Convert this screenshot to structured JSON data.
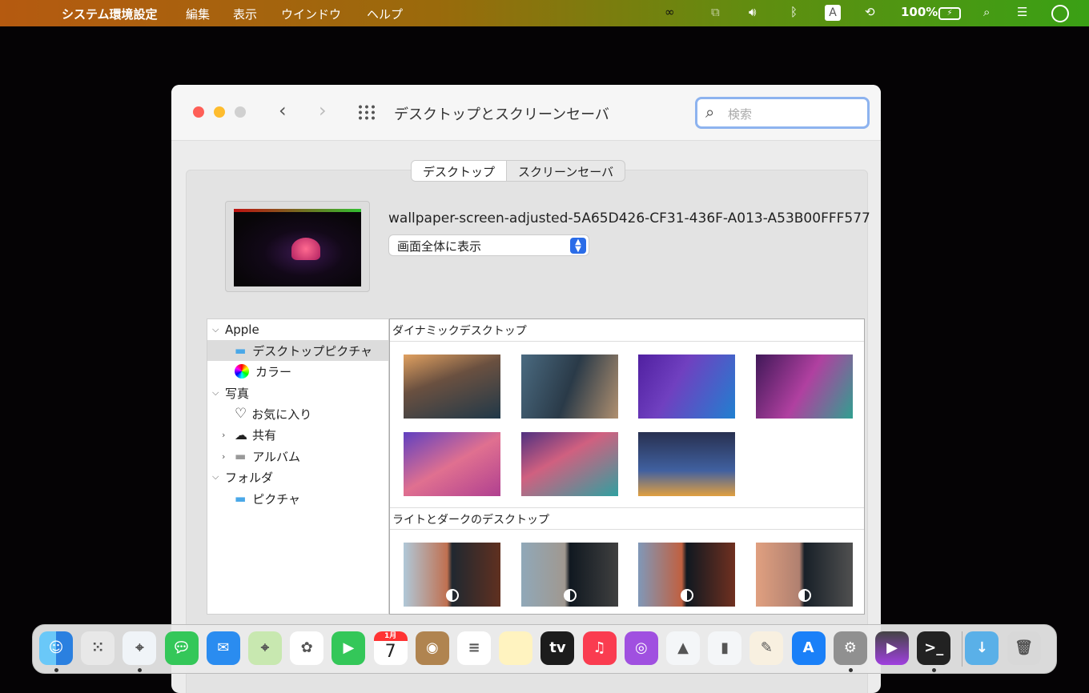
{
  "menubar": {
    "apple": "",
    "app": "システム環境設定",
    "items": [
      "編集",
      "表示",
      "ウインドウ",
      "ヘルプ"
    ],
    "status": {
      "battery": "100%",
      "input": "A"
    }
  },
  "window": {
    "title": "デスクトップとスクリーンセーバ",
    "search_placeholder": "検索",
    "tabs": [
      "デスクトップ",
      "スクリーンセーバ"
    ],
    "selected_tab": 0,
    "wallpaper_name": "wallpaper-screen-adjusted-5A65D426-CF31-436F-A013-A53B00FFF577",
    "fit_mode": "画面全体に表示",
    "sidebar": [
      {
        "label": "Apple",
        "type": "group"
      },
      {
        "label": "デスクトップピクチャ",
        "icon": "folder-icon",
        "selected": true
      },
      {
        "label": "カラー",
        "icon": "color-wheel-icon"
      },
      {
        "label": "写真",
        "type": "group"
      },
      {
        "label": "お気に入り",
        "icon": "heart-icon"
      },
      {
        "label": "共有",
        "icon": "cloud-icon"
      },
      {
        "label": "アルバム",
        "icon": "folder-icon"
      },
      {
        "label": "フォルダ",
        "type": "group"
      },
      {
        "label": "ピクチャ",
        "icon": "pictures-folder-icon"
      }
    ],
    "sections": [
      {
        "title": "ダイナミックデスクトップ",
        "count": 7
      },
      {
        "title": "ライトとダークのデスクトップ",
        "count": 4
      }
    ]
  },
  "dock": [
    "Finder",
    "Launchpad",
    "Safari",
    "メッセージ",
    "メール",
    "マップ",
    "写真",
    "FaceTime",
    "カレンダー",
    "連絡先",
    "リマインダー",
    "メモ",
    "TV",
    "ミュージック",
    "Podcast",
    "Keynote",
    "Numbers",
    "Pages",
    "App Store",
    "システム環境設定",
    "Final Cut Pro",
    "ターミナル",
    "ダウンロード",
    "ゴミ箱"
  ],
  "calendar": {
    "month": "1月",
    "day": "7"
  }
}
